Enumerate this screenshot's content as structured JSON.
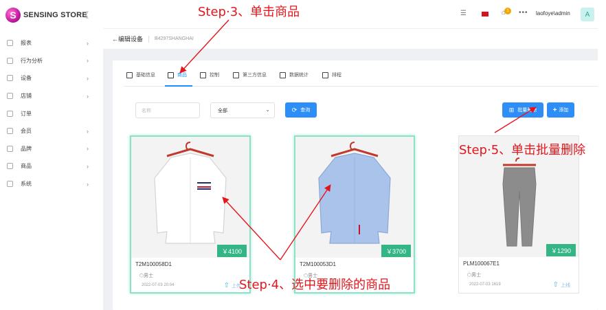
{
  "brand": {
    "logo_letter": "S",
    "name": "SENSING STORE"
  },
  "sidebar": {
    "collapse_icon": "chevrons-left-icon",
    "items": [
      {
        "label": "报表",
        "icon": "cloud-icon"
      },
      {
        "label": "行为分析",
        "icon": "chart-icon"
      },
      {
        "label": "设备",
        "icon": "device-icon"
      },
      {
        "label": "店铺",
        "icon": "store-icon"
      },
      {
        "label": "订单",
        "icon": "order-icon"
      },
      {
        "label": "会员",
        "icon": "member-icon"
      },
      {
        "label": "品牌",
        "icon": "brand-icon"
      },
      {
        "label": "商品",
        "icon": "product-icon"
      },
      {
        "label": "系统",
        "icon": "settings-icon"
      }
    ]
  },
  "topbar": {
    "user": "laofoye\\admin",
    "avatar": "A",
    "notification_count": "1",
    "flag_color": "#d8121f"
  },
  "breadcrumb": {
    "back": "←编辑设备",
    "device_id": "B4297SHANGHAI"
  },
  "tabs": [
    {
      "label": "基础信息"
    },
    {
      "label": "商品"
    },
    {
      "label": "控制"
    },
    {
      "label": "第三方信息"
    },
    {
      "label": "数据统计"
    },
    {
      "label": "排程"
    }
  ],
  "filters": {
    "name_placeholder": "名称",
    "select_value": "全部",
    "query_label": "查询",
    "batch_label": "批量删除",
    "add_label": "添加"
  },
  "products": [
    {
      "code": "T2M100058D1",
      "price": "￥4100",
      "tag": "男士",
      "date": "2022-07-03 20:04",
      "action": "上传",
      "selected": true,
      "color": "#ffffff"
    },
    {
      "code": "T2M100053D1",
      "price": "￥3700",
      "tag": "男士",
      "date": "",
      "action": "",
      "selected": true,
      "color": "#a9c3ea"
    },
    {
      "code": "PLM100067E1",
      "price": "￥1290",
      "tag": "男士",
      "date": "2022-07-03 1619",
      "action": "上线",
      "selected": false,
      "color": "#8c8c8c"
    }
  ],
  "annotations": {
    "step3": "Step·3、单击商品",
    "step4": "Step·4、选中要删除的商品",
    "step5": "Step·5、单击批量删除"
  },
  "colors": {
    "accent": "#1890ff",
    "button": "#2e8ef7",
    "price_badge": "#34b586",
    "selected_border": "#8ee0c9",
    "annotation": "#e4161c"
  }
}
